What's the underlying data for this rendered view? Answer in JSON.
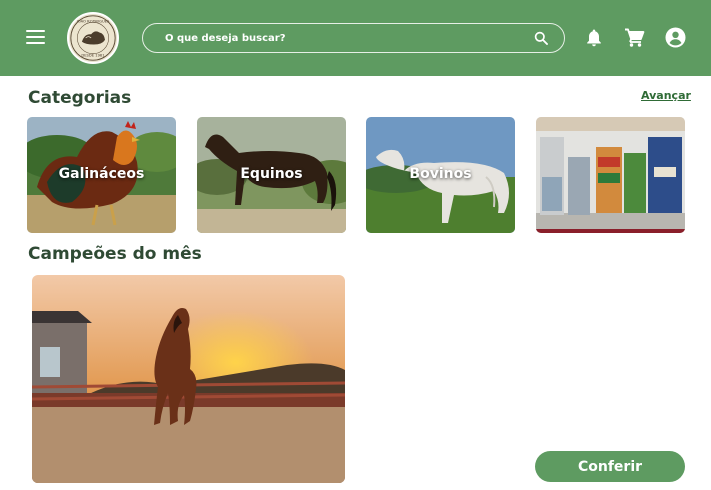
{
  "header": {
    "menu_icon": "hamburger-menu-icon",
    "logo_text_top": "JOÃO RODRIGUES",
    "logo_text_bottom": "DESDE 1961",
    "search": {
      "placeholder": "O que deseja buscar?",
      "value": ""
    },
    "icons": [
      "search-icon",
      "bell-icon",
      "cart-icon",
      "account-icon"
    ]
  },
  "categories": {
    "title": "Categorias",
    "advance_label": "Avançar",
    "items": [
      {
        "label": "Galináceos"
      },
      {
        "label": "Equinos"
      },
      {
        "label": "Bovinos"
      },
      {
        "label": ""
      }
    ]
  },
  "champions": {
    "title": "Campeões do mês",
    "button_label": "Conferir"
  },
  "colors": {
    "brand_green": "#5e9b61",
    "title_text": "#2f4a34",
    "link": "#2f6b36"
  }
}
